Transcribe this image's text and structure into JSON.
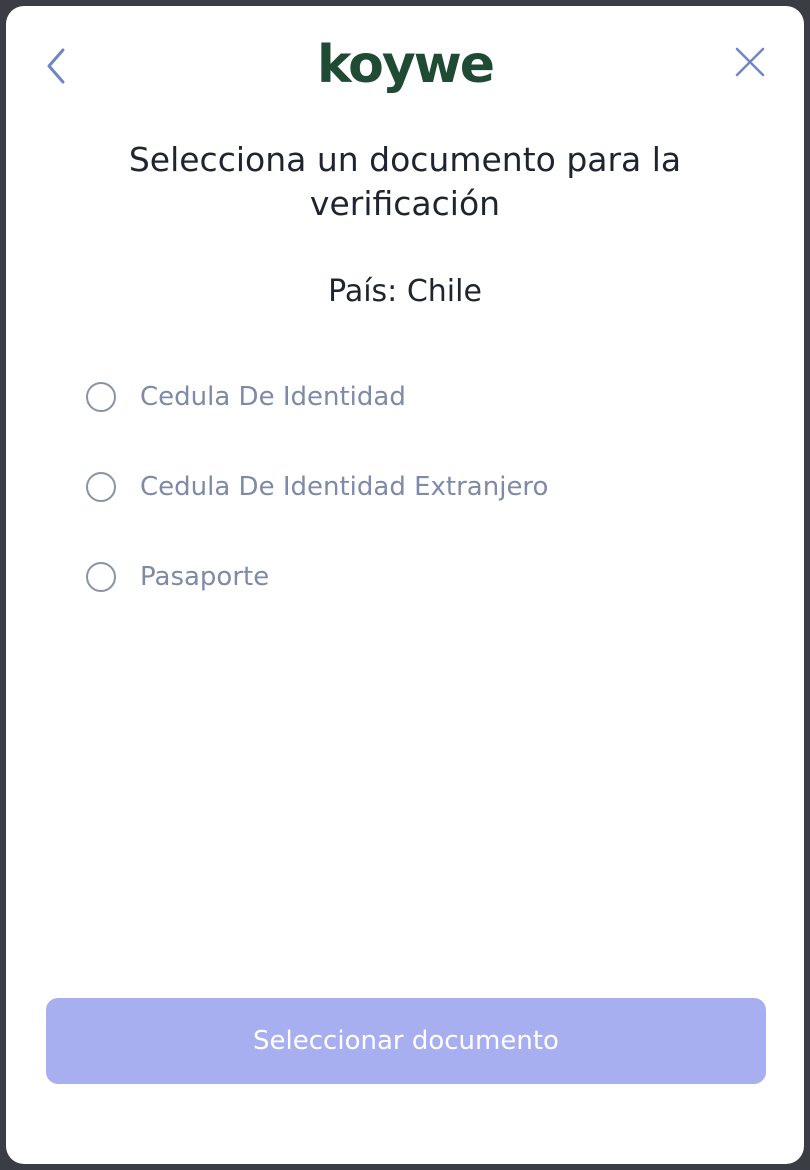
{
  "header": {
    "logo_text": "koywe",
    "back_icon": "chevron-left-icon",
    "close_icon": "close-icon",
    "logo_color": "#1f4a33",
    "icon_color": "#6f86c6"
  },
  "main": {
    "title": "Selecciona un documento para la verificación",
    "country": "País: Chile",
    "options": [
      {
        "label": "Cedula De Identidad",
        "selected": false
      },
      {
        "label": "Cedula De Identidad Extranjero",
        "selected": false
      },
      {
        "label": "Pasaporte",
        "selected": false
      }
    ]
  },
  "footer": {
    "submit_label": "Seleccionar documento",
    "submit_color": "#a7aff0",
    "submit_disabled": true
  }
}
